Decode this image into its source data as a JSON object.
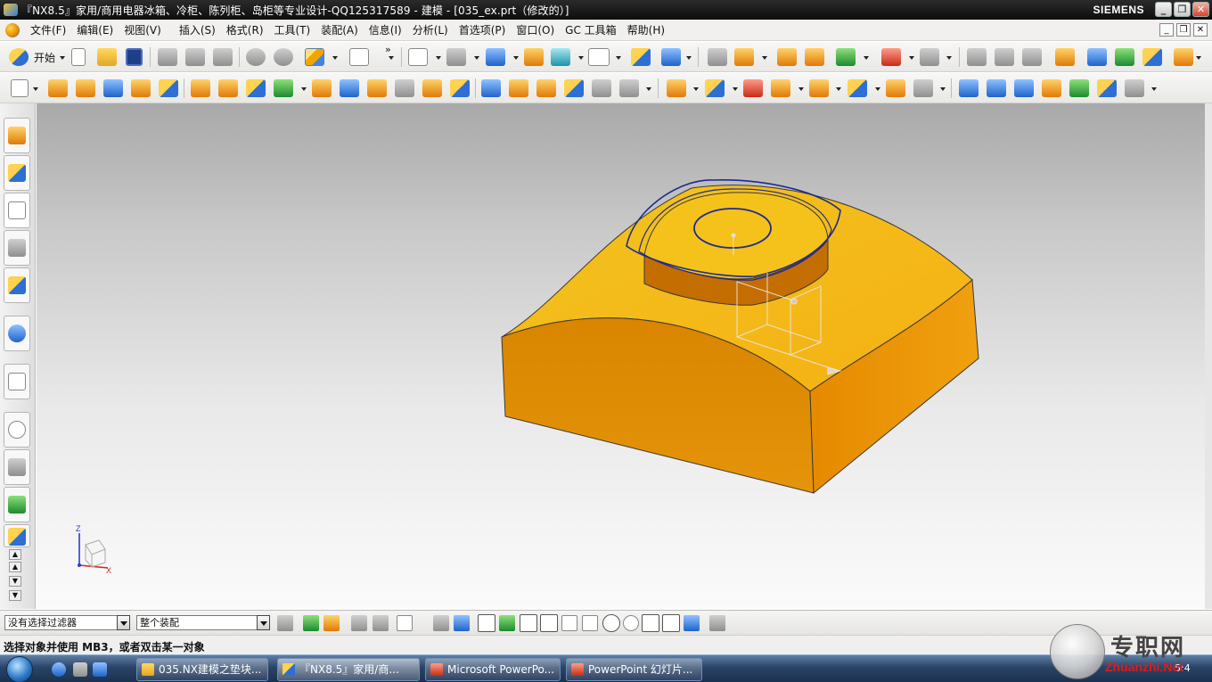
{
  "window": {
    "title": "『NX8.5』家用/商用电器冰箱、冷柜、陈列柜、岛柜等专业设计-QQ125317589 - 建模 - [035_ex.prt（修改的）]",
    "brand": "SIEMENS",
    "controls": {
      "minimize": "_",
      "restore": "❐",
      "close": "✕"
    }
  },
  "menu": {
    "items": [
      "文件(F)",
      "编辑(E)",
      "视图(V)",
      "插入(S)",
      "格式(R)",
      "工具(T)",
      "装配(A)",
      "信息(I)",
      "分析(L)",
      "首选项(P)",
      "窗口(O)",
      "GC 工具箱",
      "帮助(H)"
    ],
    "mdi_controls": {
      "minimize": "_",
      "restore": "❐",
      "close": "✕"
    }
  },
  "toolbar": {
    "start_label": "开始",
    "more": "»"
  },
  "selection_bar": {
    "type_filter": "没有选择过滤器",
    "scope": "整个装配"
  },
  "status": {
    "prompt": "选择对象并使用 MB3，或者双击某一对象"
  },
  "csys": {
    "z": "Z",
    "x": "X"
  },
  "taskbar": {
    "tasks": [
      "035.NX建模之垫块...",
      "『NX8.5』家用/商...",
      "Microsoft PowerPo...",
      "PowerPoint 幻灯片..."
    ],
    "clock": "5:4"
  },
  "watermark": {
    "title": "专职网",
    "url": "Zhuanzhi.Net"
  },
  "colors": {
    "model_top": "#f2c420",
    "model_front": "#e5940a",
    "model_side": "#f0a00f",
    "boss_face": "#c96f00",
    "edge": "#3a3a3a",
    "sketch_curve": "#1d2b8f"
  }
}
